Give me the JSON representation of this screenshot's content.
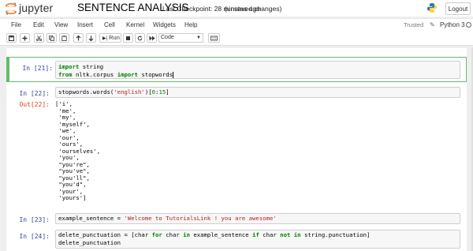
{
  "header": {
    "brand": "jupyter",
    "notebook_title": "SENTENCE ANALYSIS",
    "checkpoint": "Last Checkpoint: 28 minutes ago",
    "unsaved": "(unsaved changes)",
    "logout_label": "Logout"
  },
  "menu": {
    "items": [
      "File",
      "Edit",
      "View",
      "Insert",
      "Cell",
      "Kernel",
      "Widgets",
      "Help"
    ],
    "trusted": "Trusted",
    "kernel_name": "Python 3"
  },
  "toolbar": {
    "run_label": "Run",
    "cell_type": "Code"
  },
  "cells": [
    {
      "prompt": "In [21]:",
      "lines": [
        [
          "kw",
          "import"
        ],
        [
          "txt",
          " string"
        ]
      ],
      "line1": "string",
      "line2_from": "from",
      "line2_mod": " nltk.corpus ",
      "line2_import": "import",
      "line2_name": " stopwords"
    },
    {
      "prompt": "In [22]:",
      "code_a": "stopwords.words(",
      "code_str": "'english'",
      "code_b": ")[",
      "code_n1": "0",
      "code_colon": ":",
      "code_n2": "15",
      "code_c": "]",
      "out_prompt": "Out[22]:",
      "output": "['i',\n 'me',\n 'my',\n 'myself',\n 'we',\n 'our',\n 'ours',\n 'ourselves',\n 'you',\n \"you're\",\n \"you've\",\n \"you'll\",\n \"you'd\",\n 'your',\n 'yours']"
    },
    {
      "prompt": "In [23]:",
      "code_a": "example_sentence = ",
      "code_str": "'Welcome to TutorialsLink ! you are awesome'"
    },
    {
      "prompt": "In [24]:",
      "l1_a": "delete_punctuation = [char ",
      "l1_for": "for",
      "l1_b": " char ",
      "l1_in": "in",
      "l1_c": " example_sentence ",
      "l1_if": "if",
      "l1_d": " char ",
      "l1_notin": "not in",
      "l1_e": " string.punctuation]",
      "l2": "delete_punctuation"
    }
  ],
  "import_kw": "import",
  "colors": {
    "in_prompt": "#303f9f",
    "out_prompt": "#d84315",
    "edit_border": "#66bb6a"
  }
}
